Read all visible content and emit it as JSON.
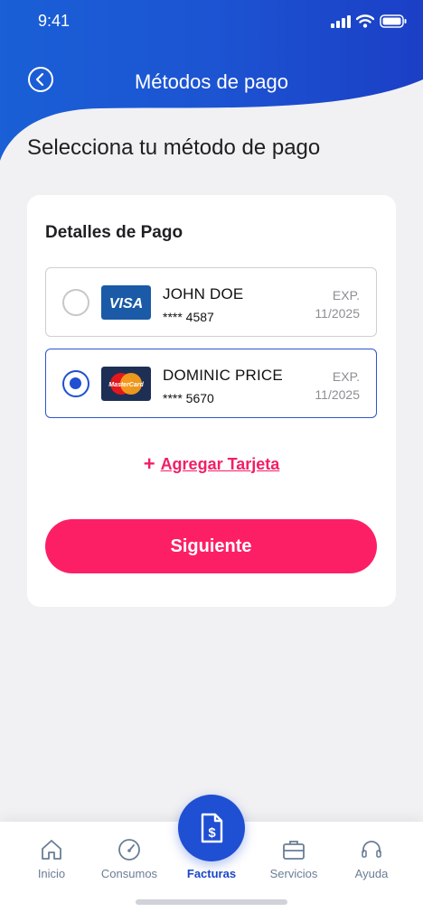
{
  "status_bar": {
    "time": "9:41"
  },
  "header": {
    "title": "Métodos de pago"
  },
  "page": {
    "heading": "Selecciona tu método de pago"
  },
  "payment_card": {
    "title": "Detalles de Pago",
    "methods": [
      {
        "holder": "JOHN DOE",
        "number": "**** 4587",
        "exp_label": "EXP.",
        "exp_date": "11/2025",
        "brand": "VISA",
        "selected": false
      },
      {
        "holder": "DOMINIC PRICE",
        "number": "**** 5670",
        "exp_label": "EXP.",
        "exp_date": "11/2025",
        "brand": "MasterCard",
        "selected": true
      }
    ],
    "add_card": {
      "plus": "+",
      "label": "Agregar Tarjeta"
    },
    "next_button": "Siguiente"
  },
  "tabbar": {
    "tabs": [
      {
        "label": "Inicio",
        "icon": "home-icon"
      },
      {
        "label": "Consumos",
        "icon": "gauge-icon"
      },
      {
        "label": "Facturas",
        "icon": "invoice-dollar-icon",
        "active": true
      },
      {
        "label": "Servicios",
        "icon": "briefcase-icon"
      },
      {
        "label": "Ayuda",
        "icon": "headset-icon"
      }
    ]
  },
  "colors": {
    "brand_blue": "#1f4fd2",
    "accent_pink": "#fd1f66",
    "visa_blue": "#1a5aa6",
    "mastercard_bg": "#1d2f55"
  }
}
